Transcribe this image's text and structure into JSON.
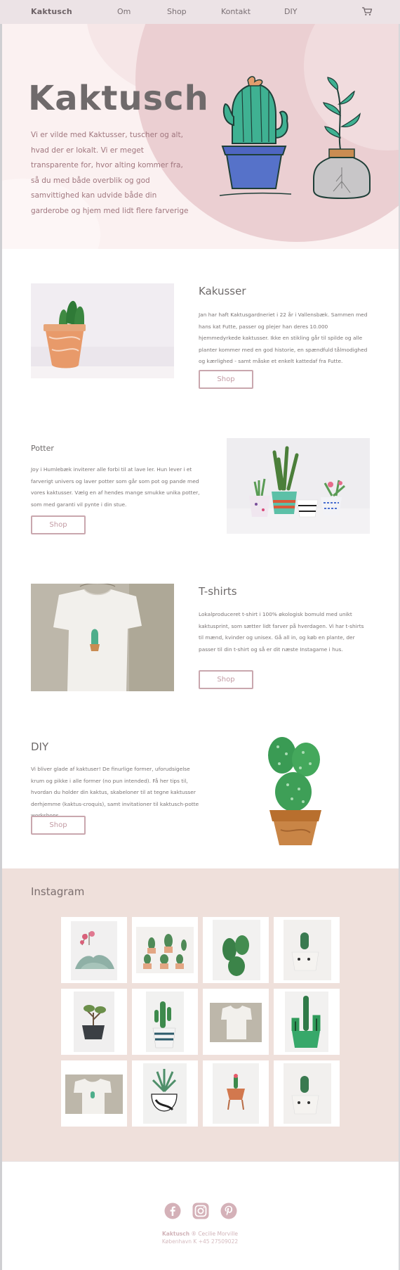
{
  "nav": {
    "brand": "Kaktusch",
    "links": [
      "Om",
      "Shop",
      "Kontakt",
      "DIY"
    ],
    "cart_icon": "cart-icon"
  },
  "hero": {
    "title": "Kaktusch",
    "text": "Vi er vilde med Kaktusser, tuscher og alt, hvad der er lokalt. Vi er meget transparente for, hvor alting kommer fra, så du med både overblik og god samvittighed kan udvide både din garderobe og hjem med lidt flere farverige"
  },
  "sections": [
    {
      "title": "Kakusser",
      "text": "Jan har haft Kaktusgardneriet i 22 år i Vallensbæk. Sammen med hans kat Futte, passer og plejer han deres 10.000 hjemmedyrkede kaktusser. Ikke en stikling går til spilde og alle planter kommer med en god historie, en spændfuld tålmodighed og kærlighed - samt måske et enkelt kattedaf fra Futte.",
      "button": "Shop"
    },
    {
      "title": "Potter",
      "text": "Joy i Humlebæk inviterer alle forbi til at lave ler. Hun lever i et farverigt univers og laver potter som går som pot og pande med vores kaktusser. Vælg en af hendes mange smukke unika potter, som med garanti vil pynte i din stue.",
      "button": "Shop"
    },
    {
      "title": "T-shirts",
      "text": "Lokalproduceret t-shirt i 100% økologisk bomuld med unikt kaktusprint, som sætter lidt farver på hverdagen. Vi har t-shirts til mænd, kvinder og unisex. Gå all in, og køb en plante, der passer til din t-shirt og så er dit næste Instagame i hus.",
      "button": "Shop"
    },
    {
      "title": "DIY",
      "text": "Vi bliver glade af kaktuser! De finurlige former, uforudsigelse krum og pikke i alle former (no pun intended). Få her tips til, hvordan du holder din kaktus, skabeloner til at tegne kaktusser derhjemme (kaktus-croquis),  samt invitationer til kaktusch-potte workshops.",
      "button": "Shop"
    }
  ],
  "instagram": {
    "title": "Instagram"
  },
  "footer": {
    "brand": "Kaktusch",
    "line1_rest": " ® Cecilie Morville",
    "line2": "København K +45 27509022",
    "icons": [
      "facebook-icon",
      "instagram-icon",
      "pinterest-icon"
    ]
  },
  "colors": {
    "nav_bg": "#ece3e6",
    "hero_blob": "#ebcfd2",
    "accent": "#c29aa3",
    "instagram_bg": "#efe0db"
  }
}
